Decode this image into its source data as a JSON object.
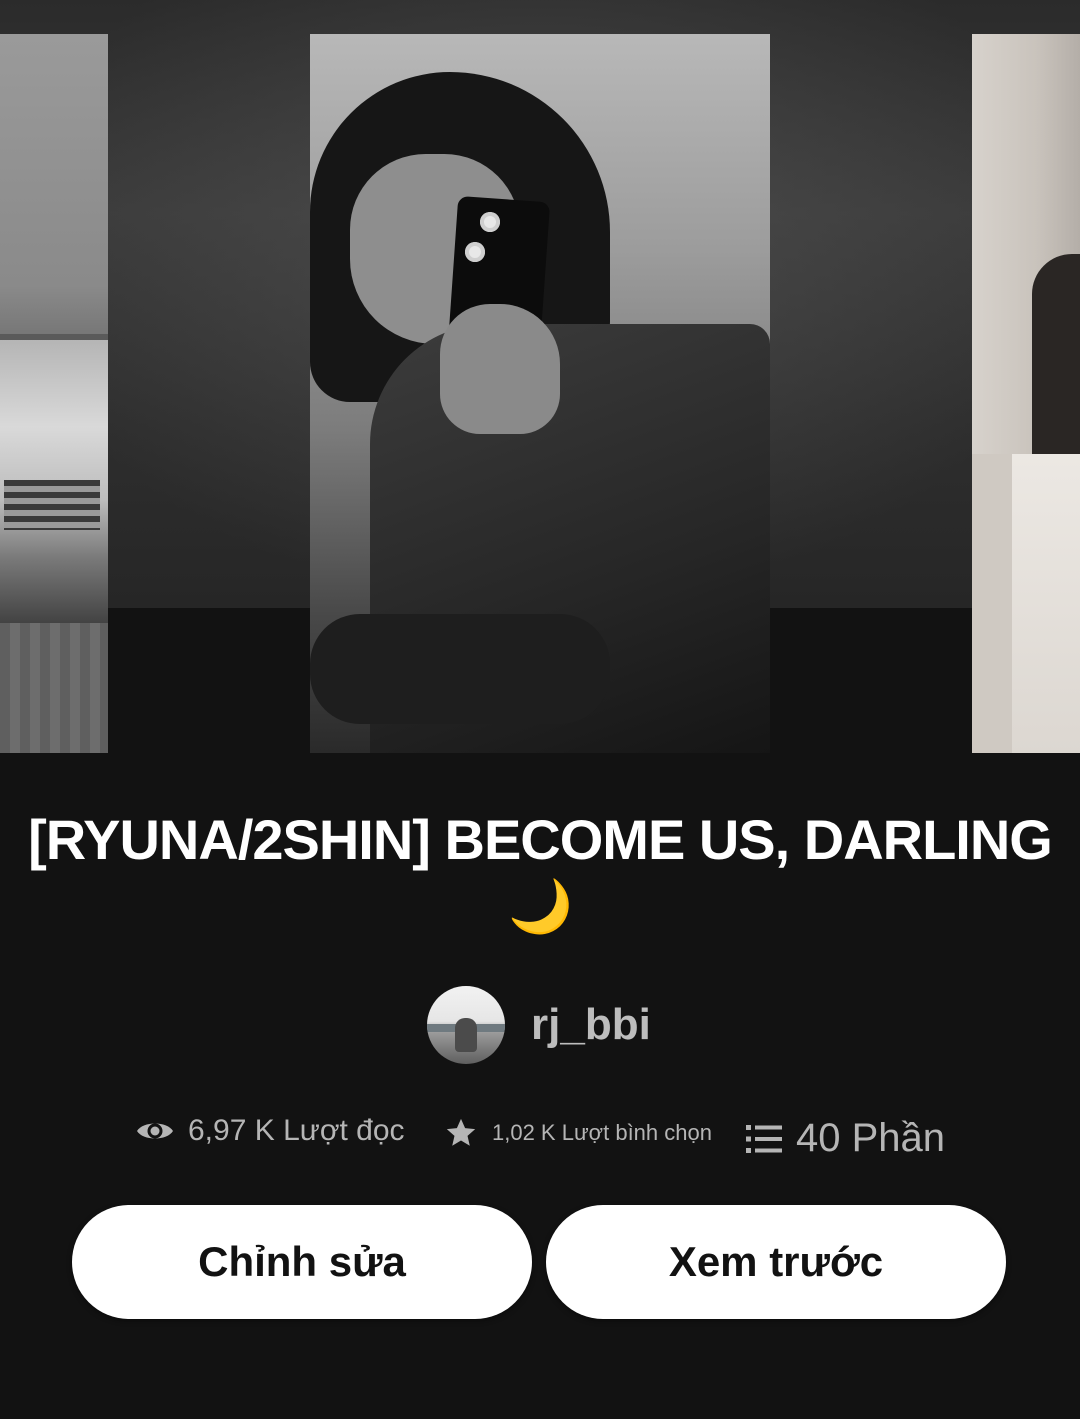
{
  "story": {
    "title": "[RYUNA/2SHIN] BECOME US, DARLING",
    "title_emoji": "🌙",
    "author": "rj_bbi"
  },
  "stats": {
    "reads": "6,97 K Lượt đọc",
    "votes": "1,02 K Lượt bình chọn",
    "parts": "40 Phần"
  },
  "actions": {
    "edit_label": "Chỉnh sửa",
    "preview_label": "Xem trước"
  },
  "icons": {
    "reads": "eye-icon",
    "votes": "star-icon",
    "parts": "list-icon"
  },
  "colors": {
    "background": "#121212",
    "stat_text": "#b5b5b5",
    "button_bg": "#ffffff",
    "button_text": "#121212",
    "moon": "#f6c343"
  }
}
